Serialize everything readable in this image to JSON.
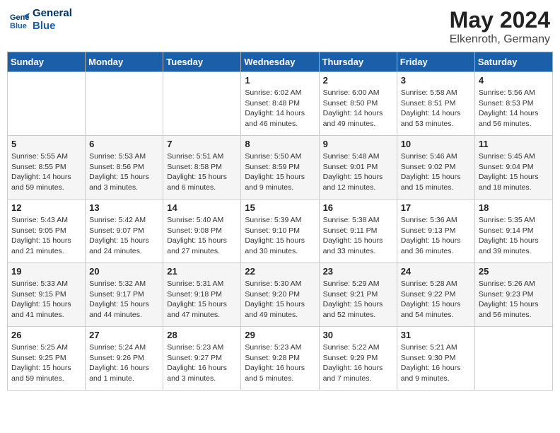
{
  "header": {
    "logo_line1": "General",
    "logo_line2": "Blue",
    "month": "May 2024",
    "location": "Elkenroth, Germany"
  },
  "weekdays": [
    "Sunday",
    "Monday",
    "Tuesday",
    "Wednesday",
    "Thursday",
    "Friday",
    "Saturday"
  ],
  "weeks": [
    [
      {
        "day": "",
        "info": ""
      },
      {
        "day": "",
        "info": ""
      },
      {
        "day": "",
        "info": ""
      },
      {
        "day": "1",
        "info": "Sunrise: 6:02 AM\nSunset: 8:48 PM\nDaylight: 14 hours\nand 46 minutes."
      },
      {
        "day": "2",
        "info": "Sunrise: 6:00 AM\nSunset: 8:50 PM\nDaylight: 14 hours\nand 49 minutes."
      },
      {
        "day": "3",
        "info": "Sunrise: 5:58 AM\nSunset: 8:51 PM\nDaylight: 14 hours\nand 53 minutes."
      },
      {
        "day": "4",
        "info": "Sunrise: 5:56 AM\nSunset: 8:53 PM\nDaylight: 14 hours\nand 56 minutes."
      }
    ],
    [
      {
        "day": "5",
        "info": "Sunrise: 5:55 AM\nSunset: 8:55 PM\nDaylight: 14 hours\nand 59 minutes."
      },
      {
        "day": "6",
        "info": "Sunrise: 5:53 AM\nSunset: 8:56 PM\nDaylight: 15 hours\nand 3 minutes."
      },
      {
        "day": "7",
        "info": "Sunrise: 5:51 AM\nSunset: 8:58 PM\nDaylight: 15 hours\nand 6 minutes."
      },
      {
        "day": "8",
        "info": "Sunrise: 5:50 AM\nSunset: 8:59 PM\nDaylight: 15 hours\nand 9 minutes."
      },
      {
        "day": "9",
        "info": "Sunrise: 5:48 AM\nSunset: 9:01 PM\nDaylight: 15 hours\nand 12 minutes."
      },
      {
        "day": "10",
        "info": "Sunrise: 5:46 AM\nSunset: 9:02 PM\nDaylight: 15 hours\nand 15 minutes."
      },
      {
        "day": "11",
        "info": "Sunrise: 5:45 AM\nSunset: 9:04 PM\nDaylight: 15 hours\nand 18 minutes."
      }
    ],
    [
      {
        "day": "12",
        "info": "Sunrise: 5:43 AM\nSunset: 9:05 PM\nDaylight: 15 hours\nand 21 minutes."
      },
      {
        "day": "13",
        "info": "Sunrise: 5:42 AM\nSunset: 9:07 PM\nDaylight: 15 hours\nand 24 minutes."
      },
      {
        "day": "14",
        "info": "Sunrise: 5:40 AM\nSunset: 9:08 PM\nDaylight: 15 hours\nand 27 minutes."
      },
      {
        "day": "15",
        "info": "Sunrise: 5:39 AM\nSunset: 9:10 PM\nDaylight: 15 hours\nand 30 minutes."
      },
      {
        "day": "16",
        "info": "Sunrise: 5:38 AM\nSunset: 9:11 PM\nDaylight: 15 hours\nand 33 minutes."
      },
      {
        "day": "17",
        "info": "Sunrise: 5:36 AM\nSunset: 9:13 PM\nDaylight: 15 hours\nand 36 minutes."
      },
      {
        "day": "18",
        "info": "Sunrise: 5:35 AM\nSunset: 9:14 PM\nDaylight: 15 hours\nand 39 minutes."
      }
    ],
    [
      {
        "day": "19",
        "info": "Sunrise: 5:33 AM\nSunset: 9:15 PM\nDaylight: 15 hours\nand 41 minutes."
      },
      {
        "day": "20",
        "info": "Sunrise: 5:32 AM\nSunset: 9:17 PM\nDaylight: 15 hours\nand 44 minutes."
      },
      {
        "day": "21",
        "info": "Sunrise: 5:31 AM\nSunset: 9:18 PM\nDaylight: 15 hours\nand 47 minutes."
      },
      {
        "day": "22",
        "info": "Sunrise: 5:30 AM\nSunset: 9:20 PM\nDaylight: 15 hours\nand 49 minutes."
      },
      {
        "day": "23",
        "info": "Sunrise: 5:29 AM\nSunset: 9:21 PM\nDaylight: 15 hours\nand 52 minutes."
      },
      {
        "day": "24",
        "info": "Sunrise: 5:28 AM\nSunset: 9:22 PM\nDaylight: 15 hours\nand 54 minutes."
      },
      {
        "day": "25",
        "info": "Sunrise: 5:26 AM\nSunset: 9:23 PM\nDaylight: 15 hours\nand 56 minutes."
      }
    ],
    [
      {
        "day": "26",
        "info": "Sunrise: 5:25 AM\nSunset: 9:25 PM\nDaylight: 15 hours\nand 59 minutes."
      },
      {
        "day": "27",
        "info": "Sunrise: 5:24 AM\nSunset: 9:26 PM\nDaylight: 16 hours\nand 1 minute."
      },
      {
        "day": "28",
        "info": "Sunrise: 5:23 AM\nSunset: 9:27 PM\nDaylight: 16 hours\nand 3 minutes."
      },
      {
        "day": "29",
        "info": "Sunrise: 5:23 AM\nSunset: 9:28 PM\nDaylight: 16 hours\nand 5 minutes."
      },
      {
        "day": "30",
        "info": "Sunrise: 5:22 AM\nSunset: 9:29 PM\nDaylight: 16 hours\nand 7 minutes."
      },
      {
        "day": "31",
        "info": "Sunrise: 5:21 AM\nSunset: 9:30 PM\nDaylight: 16 hours\nand 9 minutes."
      },
      {
        "day": "",
        "info": ""
      }
    ]
  ]
}
